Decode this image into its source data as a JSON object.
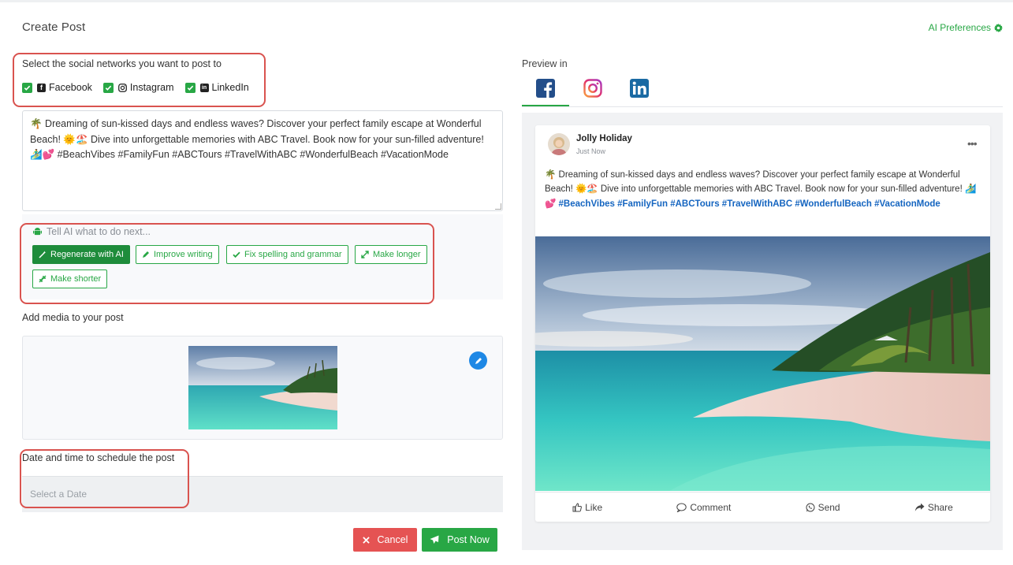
{
  "header": {
    "title": "Create Post",
    "ai_preferences_label": "AI Preferences"
  },
  "networks": {
    "label": "Select the social networks you want to post to",
    "items": [
      {
        "name": "Facebook",
        "checked": true,
        "icon": "facebook-icon"
      },
      {
        "name": "Instagram",
        "checked": true,
        "icon": "instagram-icon"
      },
      {
        "name": "LinkedIn",
        "checked": true,
        "icon": "linkedin-icon"
      }
    ]
  },
  "editor": {
    "text": "🌴 Dreaming of sun-kissed days and endless waves? Discover your perfect family escape at Wonderful Beach! 🌞🏖️ Dive into unforgettable memories with ABC Travel. Book now for your sun-filled adventure! 🏄‍♂️💕 #BeachVibes #FamilyFun #ABCTours #TravelWithABC #WonderfulBeach #VacationMode"
  },
  "ai": {
    "prompt_placeholder": "Tell AI what to do next...",
    "buttons": [
      {
        "label": "Regenerate with AI",
        "icon": "magic-wand-icon"
      },
      {
        "label": "Improve writing",
        "icon": "pencil-icon"
      },
      {
        "label": "Fix spelling and grammar",
        "icon": "check-icon"
      },
      {
        "label": "Make longer",
        "icon": "expand-icon"
      },
      {
        "label": "Make shorter",
        "icon": "compress-icon"
      }
    ]
  },
  "media": {
    "label": "Add media to your post"
  },
  "schedule": {
    "label": "Date and time to schedule the post",
    "placeholder": "Select a Date"
  },
  "footer": {
    "cancel_label": "Cancel",
    "post_label": "Post Now"
  },
  "preview": {
    "label": "Preview in",
    "tabs": [
      "facebook",
      "instagram",
      "linkedin"
    ],
    "active_tab": "facebook",
    "author": "Jolly Holiday",
    "time": "Just Now",
    "body": "🌴 Dreaming of sun-kissed days and endless waves? Discover your perfect family escape at Wonderful Beach! 🌞🏖️ Dive into unforgettable memories with ABC Travel. Book now for your sun-filled adventure! 🏄‍♂️💕",
    "hashtags": "#BeachVibes #FamilyFun #ABCTours #TravelWithABC #WonderfulBeach #VacationMode",
    "actions": [
      "Like",
      "Comment",
      "Send",
      "Share"
    ]
  },
  "colors": {
    "accent": "#28a745",
    "danger": "#e55353",
    "highlight": "#d9534f",
    "link": "#1565c0"
  }
}
